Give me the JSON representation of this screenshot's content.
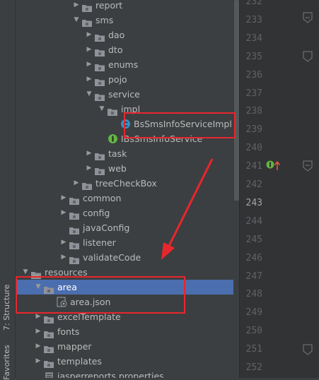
{
  "sidebar": {
    "tabs": [
      {
        "label": "7: Structure"
      },
      {
        "label": "Favorites"
      }
    ]
  },
  "tree": {
    "items": [
      {
        "label": "report",
        "kind": "folder",
        "depth": 5,
        "state": "collapsed"
      },
      {
        "label": "sms",
        "kind": "folder",
        "depth": 5,
        "state": "expanded"
      },
      {
        "label": "dao",
        "kind": "folder",
        "depth": 6,
        "state": "collapsed"
      },
      {
        "label": "dto",
        "kind": "folder",
        "depth": 6,
        "state": "collapsed"
      },
      {
        "label": "enums",
        "kind": "folder",
        "depth": 6,
        "state": "collapsed"
      },
      {
        "label": "pojo",
        "kind": "folder",
        "depth": 6,
        "state": "collapsed"
      },
      {
        "label": "service",
        "kind": "folder",
        "depth": 6,
        "state": "expanded"
      },
      {
        "label": "impl",
        "kind": "folder",
        "depth": 7,
        "state": "expanded"
      },
      {
        "label": "BsSmsInfoServiceImpl",
        "kind": "class",
        "depth": 8,
        "state": "leaf"
      },
      {
        "label": "IBsSmsInfoService",
        "kind": "interface",
        "depth": 7,
        "state": "leaf"
      },
      {
        "label": "task",
        "kind": "folder",
        "depth": 6,
        "state": "collapsed"
      },
      {
        "label": "web",
        "kind": "folder",
        "depth": 6,
        "state": "collapsed"
      },
      {
        "label": "treeCheckBox",
        "kind": "folder",
        "depth": 5,
        "state": "collapsed"
      },
      {
        "label": "common",
        "kind": "folder",
        "depth": 4,
        "state": "collapsed"
      },
      {
        "label": "config",
        "kind": "folder",
        "depth": 4,
        "state": "collapsed"
      },
      {
        "label": "javaConfig",
        "kind": "folder",
        "depth": 4,
        "state": "leaf"
      },
      {
        "label": "listener",
        "kind": "folder",
        "depth": 4,
        "state": "collapsed"
      },
      {
        "label": "validateCode",
        "kind": "folder",
        "depth": 4,
        "state": "collapsed"
      },
      {
        "label": "resources",
        "kind": "resfolder",
        "depth": 1,
        "state": "expanded"
      },
      {
        "label": "area",
        "kind": "folder",
        "depth": 2,
        "state": "expanded",
        "selected": true
      },
      {
        "label": "area.json",
        "kind": "json",
        "depth": 3,
        "state": "leaf"
      },
      {
        "label": "excelTemplate",
        "kind": "folder",
        "depth": 2,
        "state": "collapsed"
      },
      {
        "label": "fonts",
        "kind": "folder",
        "depth": 2,
        "state": "collapsed"
      },
      {
        "label": "mapper",
        "kind": "folder",
        "depth": 2,
        "state": "collapsed"
      },
      {
        "label": "templates",
        "kind": "folder",
        "depth": 2,
        "state": "collapsed"
      },
      {
        "label": "jasperreports.properties",
        "kind": "properties",
        "depth": 2,
        "state": "leaf"
      }
    ]
  },
  "gutter": {
    "current_line": "243",
    "lines": [
      "232",
      "233",
      "234",
      "235",
      "236",
      "237",
      "238",
      "239",
      "240",
      "241",
      "242",
      "243",
      "244",
      "245",
      "246",
      "247",
      "248",
      "249",
      "250",
      "251",
      "252"
    ]
  },
  "colors": {
    "selection": "#4b6eaf",
    "highlight_box": "#e8262e",
    "annotation_arrow": "#e8262e",
    "class_icon": "#3592c4",
    "interface_icon": "#62b543"
  }
}
